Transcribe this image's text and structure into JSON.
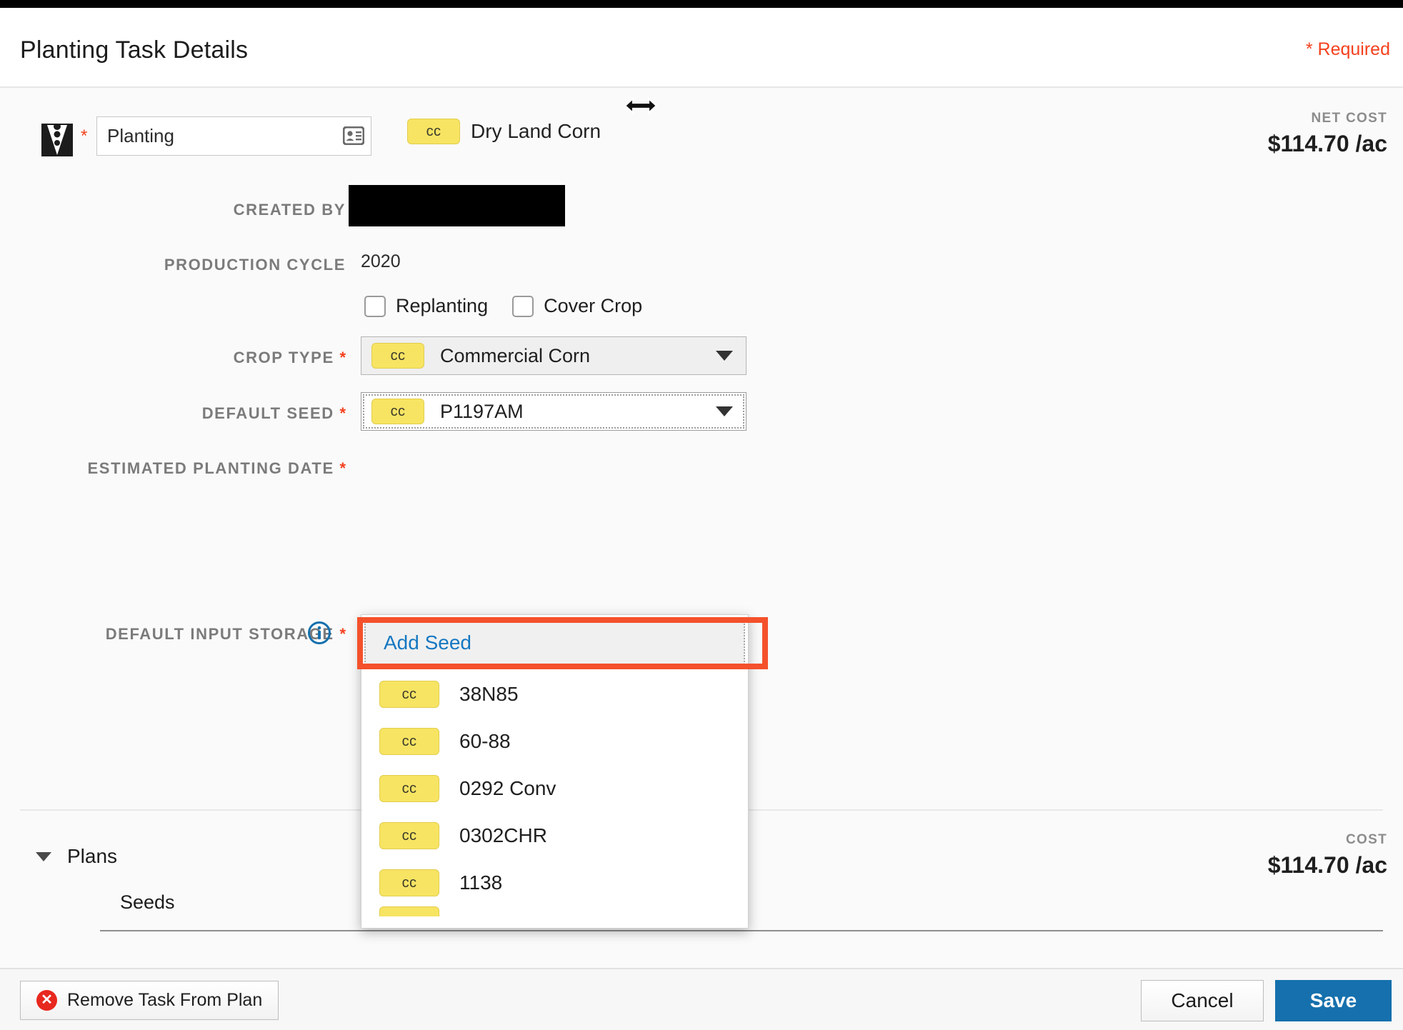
{
  "window": {
    "title": "Planting Task Details",
    "required_note": "* Required"
  },
  "header": {
    "task_icon": "planting-icon",
    "required_star": "*",
    "name_value": "Planting",
    "name_field_icon": "contact-card-icon",
    "crop_badge": "cc",
    "crop_label": "Dry Land Corn",
    "resize_cursor_icon": "horizontal-resize-cursor",
    "net_cost_label": "NET COST",
    "net_cost_value": "$114.70 /ac"
  },
  "fields": {
    "created_by_label": "CREATED BY",
    "created_by_value": "",
    "production_cycle_label": "PRODUCTION CYCLE",
    "production_cycle_value": "2020",
    "replanting_label": "Replanting",
    "cover_crop_label": "Cover Crop",
    "crop_type_label": "CROP TYPE",
    "crop_type_star": "*",
    "crop_type_badge": "cc",
    "crop_type_value": "Commercial Corn",
    "default_seed_label": "DEFAULT SEED",
    "default_seed_star": "*",
    "default_seed_badge": "cc",
    "default_seed_value": "P1197AM",
    "estimated_planting_date_label": "ESTIMATED PLANTING DATE",
    "estimated_planting_date_star": "*",
    "default_input_storage_label": "DEFAULT INPUT STORAGE",
    "default_input_storage_star": "*",
    "default_input_storage_info_icon": "info-icon"
  },
  "seed_dropdown": {
    "add_seed_label": "Add Seed",
    "options": [
      {
        "badge": "cc",
        "label": "38N85"
      },
      {
        "badge": "cc",
        "label": "60-88"
      },
      {
        "badge": "cc",
        "label": "0292 Conv"
      },
      {
        "badge": "cc",
        "label": "0302CHR"
      },
      {
        "badge": "cc",
        "label": "1138"
      }
    ],
    "partial_badge": "cc"
  },
  "plans": {
    "caret_icon": "caret-down-icon",
    "title": "Plans",
    "cost_label": "COST",
    "cost_value": "$114.70 /ac",
    "seeds_title": "Seeds"
  },
  "footer": {
    "remove_icon": "remove-circle-icon",
    "remove_label": "Remove Task From Plan",
    "cancel_label": "Cancel",
    "save_label": "Save"
  },
  "colors": {
    "accent_red": "#f4411e",
    "annotation_red": "#f4512c",
    "badge_yellow": "#f7e463",
    "link_blue": "#1678c2",
    "save_blue": "#1570ad"
  }
}
